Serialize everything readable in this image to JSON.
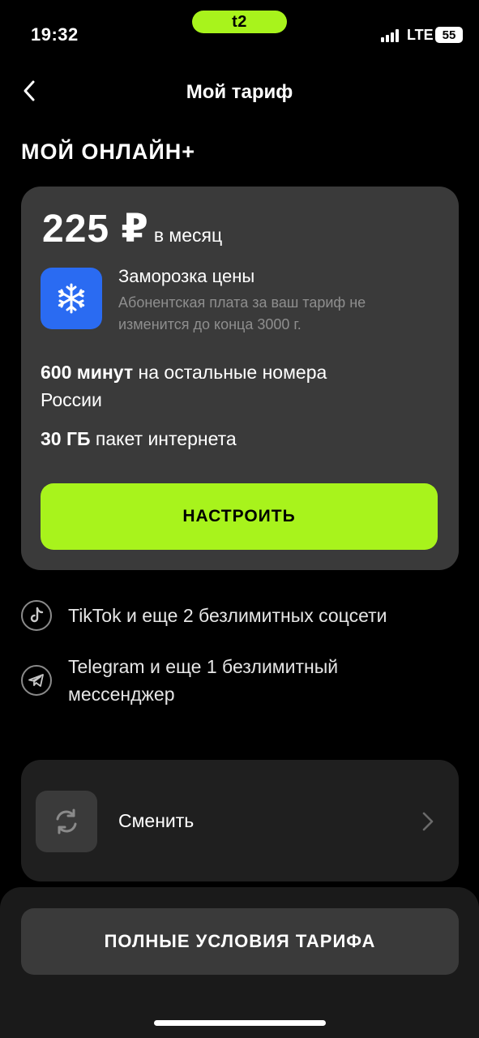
{
  "status_bar": {
    "time": "19:32",
    "brand": "t2",
    "network": "LTE",
    "battery": "55"
  },
  "header": {
    "title": "Мой тариф"
  },
  "tariff": {
    "name": "МОЙ ОНЛАЙН+",
    "price_amount": "225 ₽",
    "price_period": "в месяц",
    "freeze_title": "Заморозка цены",
    "freeze_desc": "Абонентская плата за ваш тариф не изменится до конца 3000 г.",
    "minutes_bold": "600 минут",
    "minutes_rest": " на остальные номера России",
    "data_bold": "30 ГБ",
    "data_rest": " пакет интернета",
    "configure_label": "НАСТРОИТЬ"
  },
  "perks": [
    {
      "icon": "tiktok-icon",
      "text": "TikTok и еще 2 безлимитных соцсети"
    },
    {
      "icon": "telegram-icon",
      "text": "Telegram и еще 1 безлимитный мессенджер"
    }
  ],
  "change": {
    "label": "Сменить"
  },
  "bottom": {
    "full_terms_label": "ПОЛНЫЕ УСЛОВИЯ ТАРИФА"
  },
  "colors": {
    "accent": "#a8f31c",
    "freeze": "#2a6bf2",
    "card": "#3a3a3a"
  }
}
